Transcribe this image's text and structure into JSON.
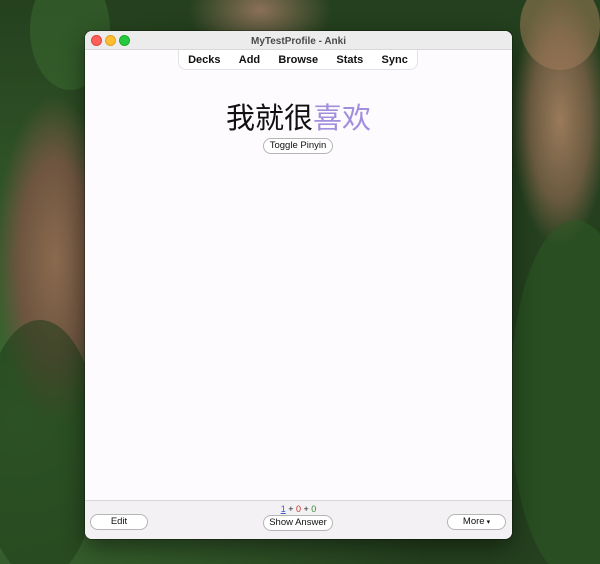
{
  "window": {
    "title": "MyTestProfile - Anki"
  },
  "toolbar": {
    "items": [
      "Decks",
      "Add",
      "Browse",
      "Stats",
      "Sync"
    ]
  },
  "card": {
    "prefix": "我就很",
    "highlight": "喜欢",
    "highlight_color": "#a08fdc"
  },
  "buttons": {
    "toggle_pinyin": "Toggle Pinyin",
    "edit": "Edit",
    "show_answer": "Show Answer",
    "more": "More",
    "more_icon": "▾"
  },
  "counts": {
    "new": "1",
    "sep1": " + ",
    "learn": "0",
    "sep2": " + ",
    "review": "0"
  },
  "colors": {
    "new": "#3b5bd6",
    "learn": "#c2332b",
    "review": "#2f8a2f",
    "window_bg": "#fdfbfe"
  }
}
